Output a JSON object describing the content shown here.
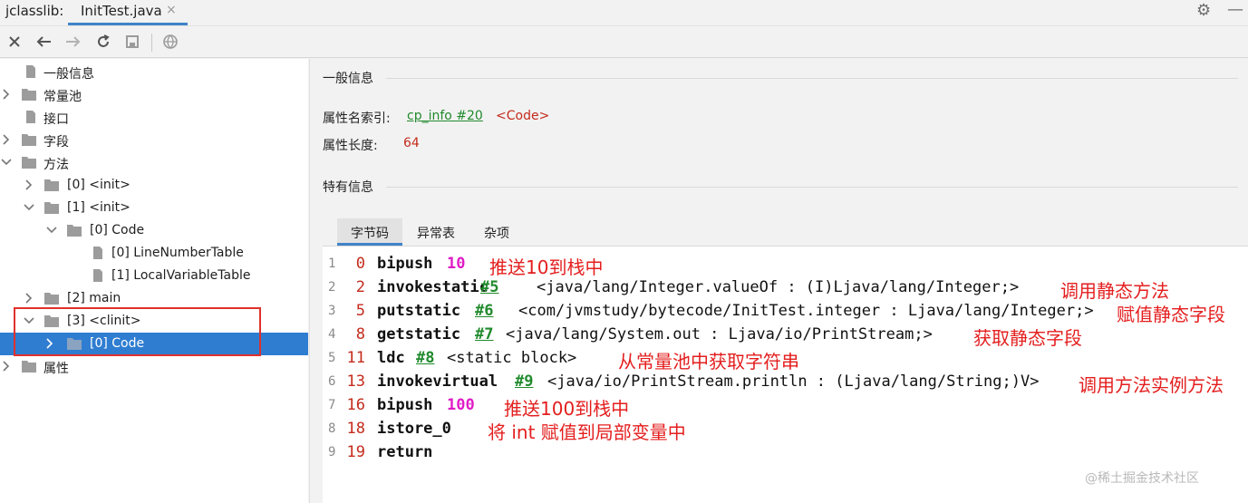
{
  "titlebar": {
    "app_label": "jclasslib:",
    "tab_label": "InitTest.java",
    "tab_close": "×",
    "gear_icon": "gear-icon",
    "minimize_icon": "minimize-icon"
  },
  "toolbar": {
    "icons": [
      "close-icon",
      "back-arrow-icon",
      "forward-arrow-icon",
      "refresh-icon",
      "save-icon",
      "browser-icon"
    ]
  },
  "tree": {
    "items": [
      {
        "label": "一般信息"
      },
      {
        "label": "常量池"
      },
      {
        "label": "接口"
      },
      {
        "label": "字段"
      },
      {
        "label": "方法"
      },
      {
        "label": "[0] <init>"
      },
      {
        "label": "[1] <init>"
      },
      {
        "label": "[0] Code"
      },
      {
        "label": "[0] LineNumberTable"
      },
      {
        "label": "[1] LocalVariableTable"
      },
      {
        "label": "[2] main"
      },
      {
        "label": "[3] <clinit>"
      },
      {
        "label": "[0] Code"
      },
      {
        "label": "属性"
      }
    ]
  },
  "general": {
    "title": "一般信息",
    "name_index_label": "属性名索引:",
    "name_index_link": "cp_info #20",
    "name_index_value": "<Code>",
    "length_label": "属性长度:",
    "length_value": "64"
  },
  "specific": {
    "title": "特有信息",
    "tabs": [
      "字节码",
      "异常表",
      "杂项"
    ]
  },
  "code": {
    "lines": [
      {
        "ln": "1",
        "offset": "0",
        "op": "bipush",
        "num": "10",
        "note": "推送10到栈中"
      },
      {
        "ln": "2",
        "offset": "2",
        "op": "invokestatic",
        "ref": "#5",
        "text": "<java/lang/Integer.valueOf : (I)Ljava/lang/Integer;>",
        "note": "调用静态方法"
      },
      {
        "ln": "3",
        "offset": "5",
        "op": "putstatic",
        "ref": "#6",
        "text": "<com/jvmstudy/bytecode/InitTest.integer : Ljava/lang/Integer;>",
        "note": "赋值静态字段"
      },
      {
        "ln": "4",
        "offset": "8",
        "op": "getstatic",
        "ref": "#7",
        "text": "<java/lang/System.out : Ljava/io/PrintStream;>",
        "note": "获取静态字段"
      },
      {
        "ln": "5",
        "offset": "11",
        "op": "ldc",
        "ref": "#8",
        "text": "<static block>",
        "note": "从常量池中获取字符串"
      },
      {
        "ln": "6",
        "offset": "13",
        "op": "invokevirtual",
        "ref": "#9",
        "text": "<java/io/PrintStream.println : (Ljava/lang/String;)V>",
        "note": "调用方法实例方法"
      },
      {
        "ln": "7",
        "offset": "16",
        "op": "bipush",
        "num": "100",
        "note": "推送100到栈中"
      },
      {
        "ln": "8",
        "offset": "18",
        "op": "istore_0",
        "note": "将 int 赋值到局部变量中"
      },
      {
        "ln": "9",
        "offset": "19",
        "op": "return"
      }
    ]
  },
  "watermark": "@稀土掘金技术社区",
  "colors": {
    "accent": "#4083c9",
    "selection": "#2f7dd1",
    "highlight_box": "#e0302c",
    "link_green": "#208a2c",
    "offset_red": "#c42b1c",
    "number_magenta": "#e01cc6",
    "annotation_red": "#e41e1e"
  }
}
